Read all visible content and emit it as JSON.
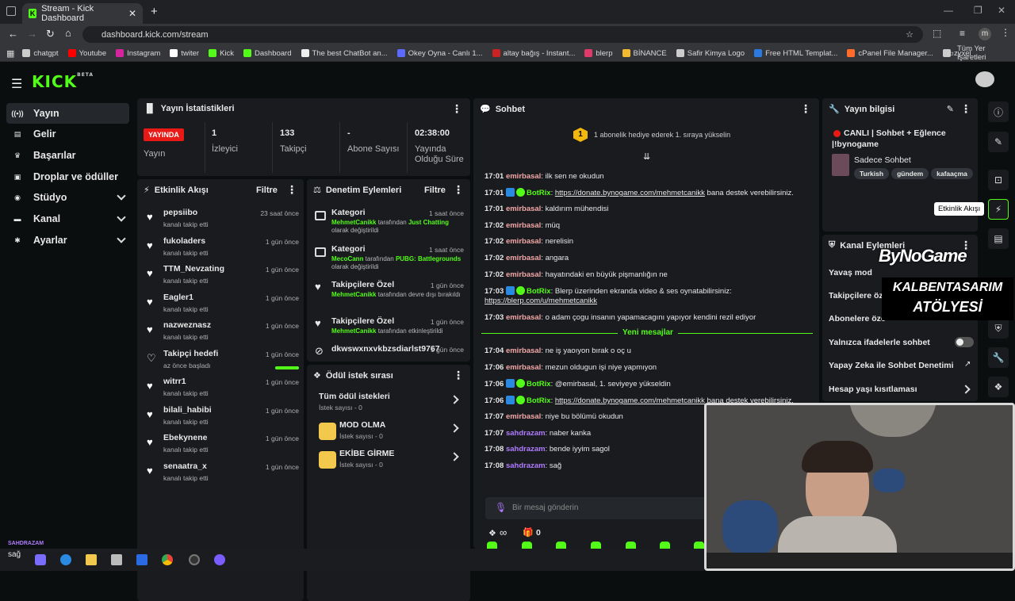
{
  "browser": {
    "tab_title": "Stream - Kick Dashboard",
    "url": "dashboard.kick.com/stream",
    "profile_initial": "m",
    "bookmarks": [
      {
        "label": "chatgpt",
        "color": "#cccccc"
      },
      {
        "label": "Youtube",
        "color": "#ff0000"
      },
      {
        "label": "Instagram",
        "color": "#d6249f"
      },
      {
        "label": "twiter",
        "color": "#ffffff"
      },
      {
        "label": "Kick",
        "color": "#53fc18"
      },
      {
        "label": "Dashboard",
        "color": "#53fc18"
      },
      {
        "label": "The best ChatBot an...",
        "color": "#eeeeee"
      },
      {
        "label": "Okey Oyna - Canlı 1...",
        "color": "#5b6bff"
      },
      {
        "label": "altay bağış - Instant...",
        "color": "#cc2222"
      },
      {
        "label": "blerp",
        "color": "#e03a6a"
      },
      {
        "label": "BİNANCE",
        "color": "#f3ba2f"
      },
      {
        "label": "Safir Kimya Logo",
        "color": "#cccccc"
      },
      {
        "label": "Free HTML Templat...",
        "color": "#2a7ae2"
      },
      {
        "label": "cPanel File Manager...",
        "color": "#ff6c2c"
      },
      {
        "label": "zyxel",
        "color": "#cccccc"
      }
    ],
    "all_bookmarks": "Tüm Yer İşaretleri"
  },
  "logo": {
    "text": "KICK",
    "beta": "BETA"
  },
  "sidebar": {
    "items": [
      {
        "label": "Yayın",
        "icon": "broadcast-icon",
        "glyph": "((•))"
      },
      {
        "label": "Gelir",
        "icon": "money-icon",
        "glyph": "▤"
      },
      {
        "label": "Başarılar",
        "icon": "trophy-icon",
        "glyph": "♛"
      },
      {
        "label": "Droplar ve ödüller",
        "icon": "gift-icon",
        "glyph": "▣"
      },
      {
        "label": "Stüdyo",
        "icon": "studio-icon",
        "glyph": "◉"
      },
      {
        "label": "Kanal",
        "icon": "channel-icon",
        "glyph": "▬"
      },
      {
        "label": "Ayarlar",
        "icon": "settings-icon",
        "glyph": "✱"
      }
    ]
  },
  "stats": {
    "title": "Yayın İstatistikleri",
    "live_badge": "YAYINDA",
    "live_label": "Yayın",
    "viewers": "1",
    "viewers_label": "İzleyici",
    "followers": "133",
    "followers_label": "Takipçi",
    "subs": "-",
    "subs_label": "Abone Sayısı",
    "uptime": "02:38:00",
    "uptime_label": "Yayında Olduğu Süre"
  },
  "activity": {
    "title": "Etkinlik Akışı",
    "filter": "Filtre",
    "events": [
      {
        "name": "pepsiibo",
        "sub": "kanalı takip etti",
        "time": "23 saat önce"
      },
      {
        "name": "fukoladers",
        "sub": "kanalı takip etti",
        "time": "1 gün önce"
      },
      {
        "name": "TTM_Nevzating",
        "sub": "kanalı takip etti",
        "time": "1 gün önce"
      },
      {
        "name": "Eagler1",
        "sub": "kanalı takip etti",
        "time": "1 gün önce"
      },
      {
        "name": "nazweznasz",
        "sub": "kanalı takip etti",
        "time": "1 gün önce"
      },
      {
        "name": "Takipçi hedefi",
        "sub": "az önce başladı",
        "time": "1 gün önce"
      },
      {
        "name": "witrr1",
        "sub": "kanalı takip etti",
        "time": "1 gün önce"
      },
      {
        "name": "bilali_habibi",
        "sub": "kanalı takip etti",
        "time": "1 gün önce"
      },
      {
        "name": "Ebekynene",
        "sub": "kanalı takip etti",
        "time": "1 gün önce"
      },
      {
        "name": "senaatra_x",
        "sub": "kanalı takip etti",
        "time": "1 gün önce"
      }
    ],
    "goal_progress": 1
  },
  "moderation": {
    "title": "Denetim Eylemleri",
    "filter": "Filtre",
    "items": [
      {
        "title": "Kategori",
        "time": "1 saat önce",
        "user": "MehmetCanikk",
        "mid": " tarafından ",
        "value": "Just Chatting",
        "tail": "olarak değiştirildi"
      },
      {
        "title": "Kategori",
        "time": "1 saat önce",
        "user": "MecoCann",
        "mid": " tarafından ",
        "value": "PUBG: Battlegrounds",
        "tail": "olarak değiştirildi"
      },
      {
        "title": "Takipçilere Özel",
        "time": "1 gün önce",
        "user": "MehmetCanikk",
        "mid": " tarafından devre dışı bırakıldı",
        "value": "",
        "tail": ""
      },
      {
        "title": "Takipçilere Özel",
        "time": "1 gün önce",
        "user": "MehmetCanikk",
        "mid": " tarafından etkinleştirildi",
        "value": "",
        "tail": ""
      },
      {
        "title": "dkwswxnxvkbzsdiarlst9767",
        "time": "1 gün önce",
        "user": "",
        "mid": "",
        "value": "",
        "tail": ""
      }
    ]
  },
  "rewards": {
    "title": "Ödül istek sırası",
    "all": "Tüm ödül istekleri",
    "all_count": "İstek sayısı - 0",
    "items": [
      {
        "name": "MOD OLMA",
        "count": "İstek sayısı - 0"
      },
      {
        "name": "EKİBE GİRME",
        "count": "İstek sayısı - 0"
      }
    ]
  },
  "chat": {
    "title": "Sohbet",
    "banner_badge": "1",
    "banner": "1 abonelik hediye ederek 1. sıraya yükselin",
    "new_messages": "Yeni mesajlar",
    "input_placeholder": "Bir mesaj gönderin",
    "infinity": "∞",
    "gift_count": "0",
    "messages": [
      {
        "time": "17:01",
        "user": "emirbasal",
        "kind": "u",
        "text": ": ilk sen ne okudun",
        "link": ""
      },
      {
        "time": "17:01",
        "user": "BotRix",
        "kind": "b",
        "text": " bana destek verebilirsiniz.",
        "link": "https://donate.bynogame.com/mehmetcanikk"
      },
      {
        "time": "17:01",
        "user": "emirbasal",
        "kind": "u",
        "text": ": kaldırım mühendisi",
        "link": ""
      },
      {
        "time": "17:02",
        "user": "emirbasal",
        "kind": "u",
        "text": ": müq",
        "link": ""
      },
      {
        "time": "17:02",
        "user": "emirbasal",
        "kind": "u",
        "text": ": nerelisin",
        "link": ""
      },
      {
        "time": "17:02",
        "user": "emirbasal",
        "kind": "u",
        "text": ": angara",
        "link": ""
      },
      {
        "time": "17:02",
        "user": "emirbasal",
        "kind": "u",
        "text": ": hayatındaki en büyük pişmanlığın ne",
        "link": ""
      },
      {
        "time": "17:03",
        "user": "BotRix",
        "kind": "b",
        "text": ": Blerp üzerinden ekranda video & ses oynatabilirsiniz:",
        "link": "https://blerp.com/u/mehmetcanikk"
      },
      {
        "time": "17:03",
        "user": "emirbasal",
        "kind": "u",
        "text": ": o adam çogu insanın yapamacagını yapıyor kendini rezil ediyor",
        "link": ""
      },
      {
        "time": "17:04",
        "user": "emirbasal",
        "kind": "u",
        "text": ": ne iş yaoıyon bırak o oç u",
        "link": ""
      },
      {
        "time": "17:06",
        "user": "emirbasal",
        "kind": "u",
        "text": ": mezun oldugun işi niye yapmıyon",
        "link": ""
      },
      {
        "time": "17:06",
        "user": "BotRix",
        "kind": "b",
        "text": ": @emirbasal, 1. seviyeye yükseldin",
        "link": ""
      },
      {
        "time": "17:06",
        "user": "BotRix",
        "kind": "b",
        "text": " bana destek verebilirsiniz.",
        "link": "https://donate.bynogame.com/mehmetcanikk"
      },
      {
        "time": "17:07",
        "user": "emirbasal",
        "kind": "u",
        "text": ": niye bu bölümü okudun",
        "link": ""
      },
      {
        "time": "17:07",
        "user": "sahdrazam",
        "kind": "p",
        "text": ": naber kanka",
        "link": ""
      },
      {
        "time": "17:08",
        "user": "sahdrazam",
        "kind": "p",
        "text": ": bende iyyim sagol",
        "link": ""
      },
      {
        "time": "17:08",
        "user": "sahdrazam",
        "kind": "p",
        "text": ": sağ",
        "link": ""
      }
    ]
  },
  "stream_info": {
    "title": "Yayın bilgisi",
    "stream_title": "CANLI | Sohbet + Eğlence |!bynogame",
    "category": "Sadece Sohbet",
    "tags": [
      "Turkish",
      "gündem",
      "kafaaçma"
    ]
  },
  "channel_actions": {
    "title": "Kanal Eylemleri",
    "slow_mode": "Yavaş mod",
    "followers_only": "Takipçilere öz",
    "subs_only": "Abonelere öze",
    "emotes_only": "Yalnızca ifadelerle sohbet",
    "ai_mod": "Yapay Zeka ile Sohbet Denetimi",
    "age_restrict": "Hesap yaşı kısıtlaması"
  },
  "tooltip": "Etkinlik Akışı",
  "overlay": {
    "brand": "ByNoGame",
    "studio_line1": "KALBENTASARIM",
    "studio_line2": "ATÖLYESİ"
  },
  "taskbar": {
    "user": "SAHDRAZAM",
    "msg": "sağ"
  }
}
